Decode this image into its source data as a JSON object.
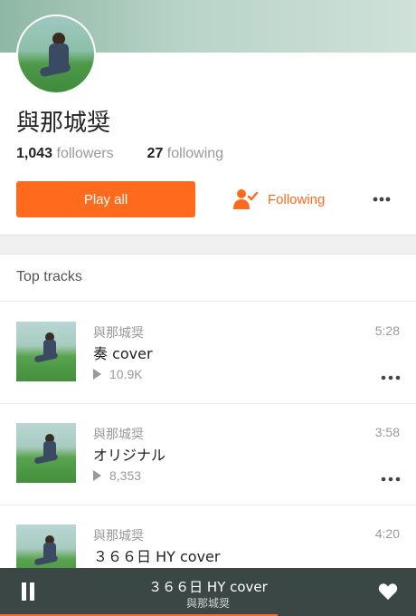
{
  "profile": {
    "name": "與那城奨",
    "followers_count": "1,043",
    "followers_label": "followers",
    "following_count": "27",
    "following_label": "following"
  },
  "actions": {
    "play_all_label": "Play all",
    "following_label": "Following",
    "accent_color": "#ff6a1c"
  },
  "top_tracks": {
    "title": "Top tracks",
    "tracks": [
      {
        "artist": "與那城奨",
        "title": "奏 cover",
        "plays": "10.9K",
        "duration": "5:28"
      },
      {
        "artist": "與那城奨",
        "title": "オリジナル",
        "plays": "8,353",
        "duration": "3:58"
      },
      {
        "artist": "與那城奨",
        "title": "３６６日 HY cover",
        "plays": "",
        "duration": "4:20"
      }
    ]
  },
  "player": {
    "title": "３６６日 HY cover",
    "artist": "與那城奨",
    "background_color": "#3a4744"
  }
}
